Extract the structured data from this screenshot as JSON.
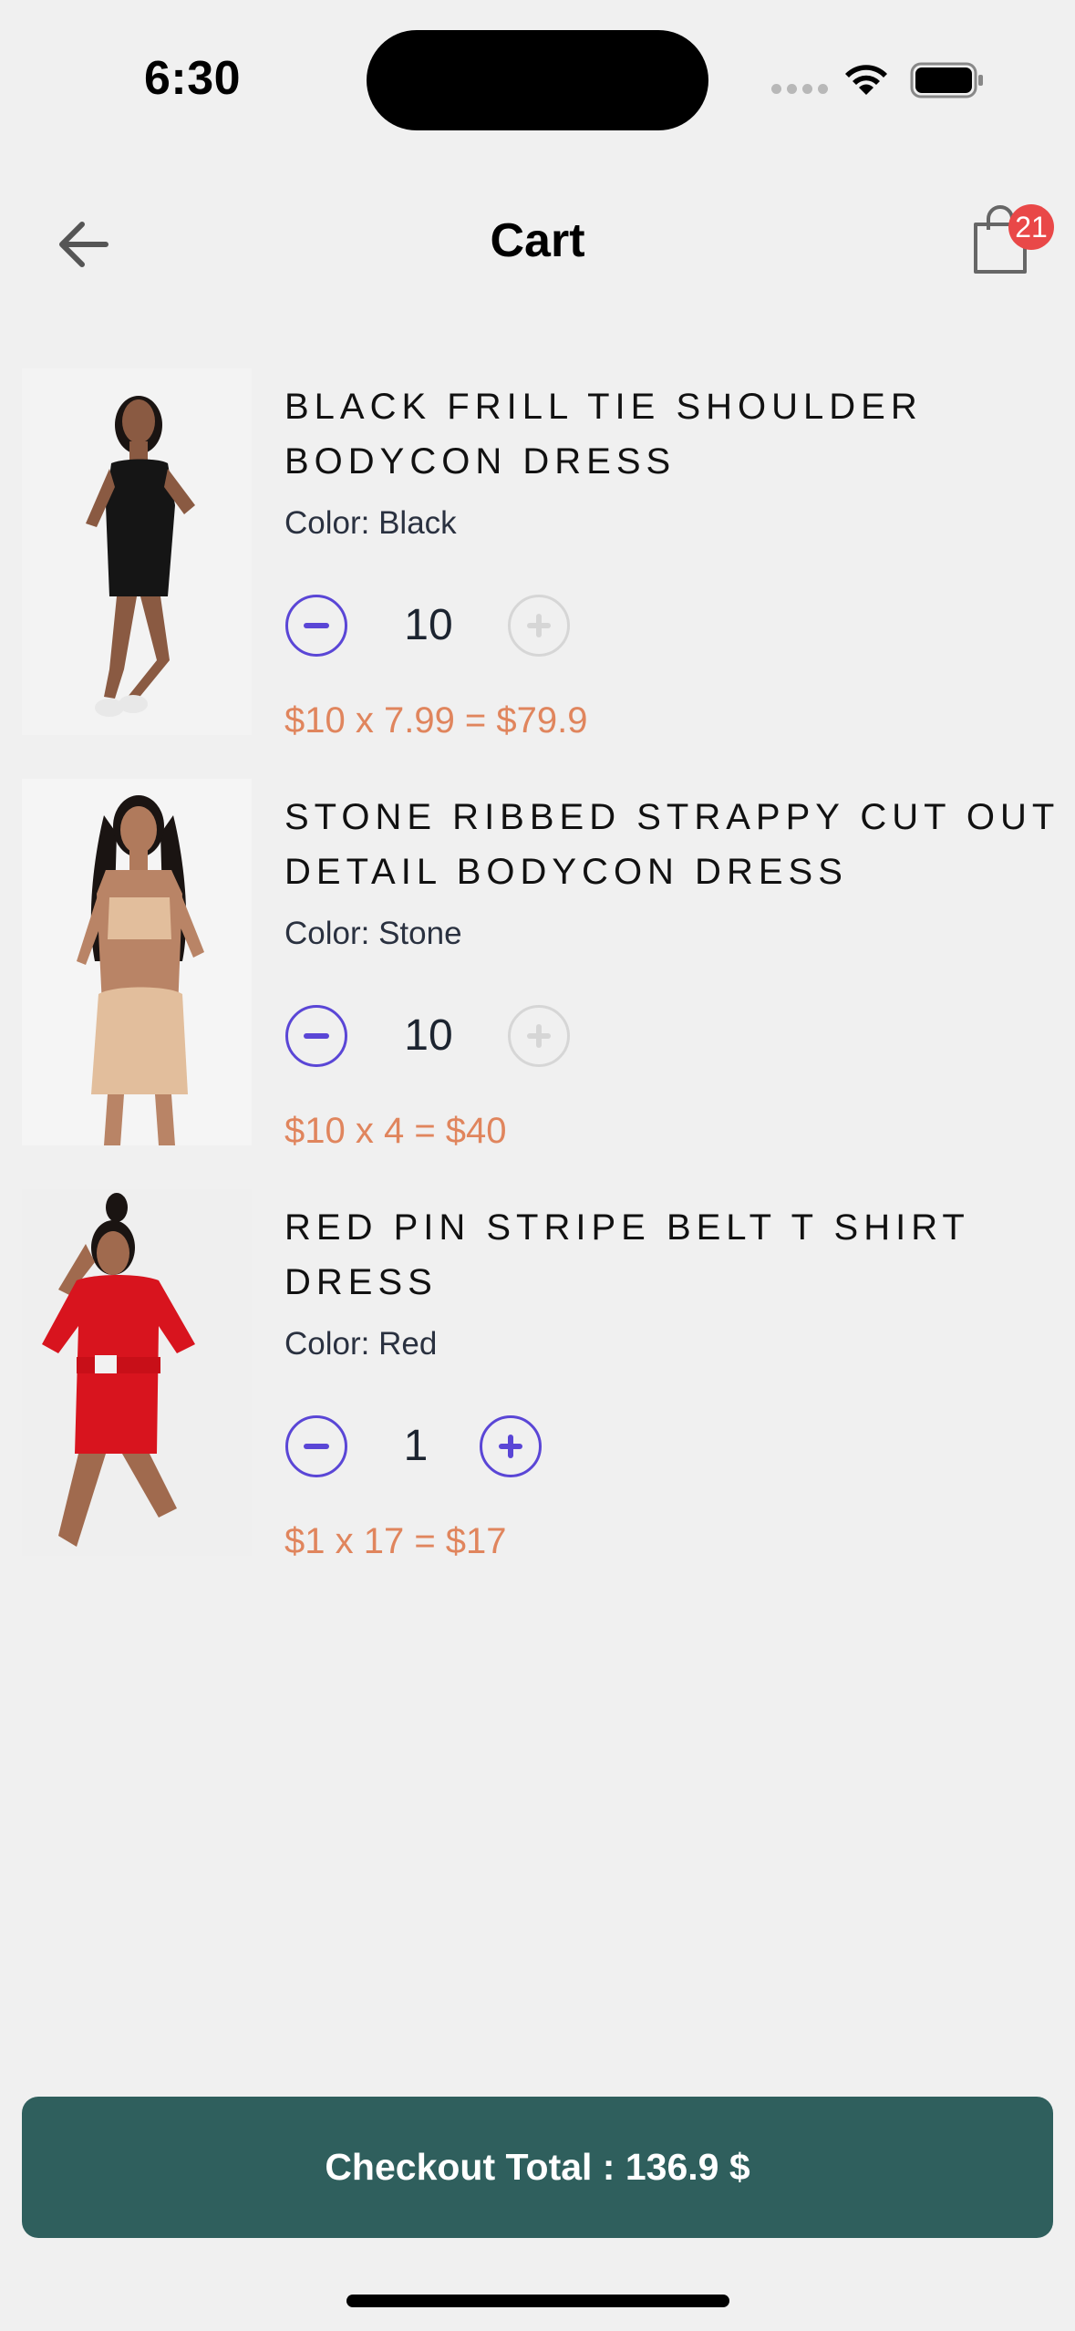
{
  "status_bar": {
    "time": "6:30"
  },
  "header": {
    "title": "Cart",
    "cart_count": "21"
  },
  "items": [
    {
      "title": "Black Frill Tie Shoulder Bodycon Dress",
      "color": "Color: Black",
      "quantity": "10",
      "price_line": "$10 x 7.99 = $79.9",
      "plus_enabled": false
    },
    {
      "title": "Stone Ribbed Strappy Cut Out Detail Bodycon Dress",
      "color": "Color: Stone",
      "quantity": "10",
      "price_line": "$10 x 4 = $40",
      "plus_enabled": false
    },
    {
      "title": "Red Pin Stripe Belt T Shirt Dress",
      "color": "Color: Red",
      "quantity": "1",
      "price_line": "$1 x 17 = $17",
      "plus_enabled": true
    }
  ],
  "checkout": {
    "label": "Checkout Total : 136.9 $"
  },
  "colors": {
    "accent": "#5a46d6",
    "price": "#e0855d",
    "checkout_bg": "#2f5f5d",
    "badge": "#e94848",
    "background": "#f0f0f0"
  }
}
